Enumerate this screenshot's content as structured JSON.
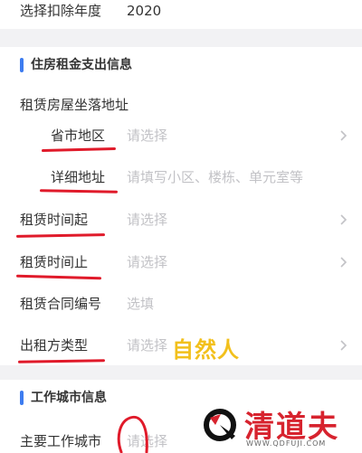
{
  "deduction_year": {
    "label": "选择扣除年度",
    "value": "2020"
  },
  "rental_section": {
    "title": "住房租金支出信息",
    "address_label": "租赁房屋坐落地址",
    "province_city": {
      "label": "省市地区",
      "placeholder": "请选择"
    },
    "detail_address": {
      "label": "详细地址",
      "placeholder": "请填写小区、楼栋、单元室等"
    },
    "start_date": {
      "label": "租赁时间起",
      "placeholder": "请选择"
    },
    "end_date": {
      "label": "租赁时间止",
      "placeholder": "请选择"
    },
    "contract_no": {
      "label": "租赁合同编号",
      "placeholder": "选填"
    },
    "lessor_type": {
      "label": "出租方类型",
      "placeholder": "请选择",
      "annotation": "自然人"
    }
  },
  "work_city_section": {
    "title": "工作城市信息",
    "main_city": {
      "label": "主要工作城市",
      "placeholder": "请选择"
    }
  },
  "watermark": {
    "title": "清道夫",
    "url": "WWW.QDFUJI.COM"
  },
  "colors": {
    "accent": "#3d7cf0",
    "annotation_red": "#e01a2a",
    "annotation_yellow": "#f2c01c",
    "watermark_red": "#d7232e"
  },
  "icons": [
    "chevron-right-icon",
    "section-accent-bar",
    "qdf-logo-icon"
  ]
}
